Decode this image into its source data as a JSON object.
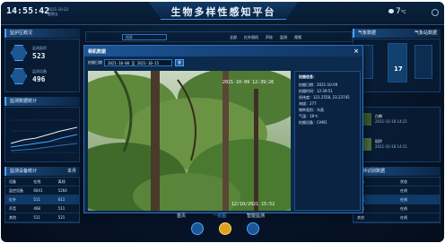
{
  "header": {
    "time": "14:55:42",
    "date_line1": "2021-10-22",
    "date_line2": "星期五",
    "title": "生物多样性感知平台",
    "weather_temp": "7",
    "weather_unit": "°C"
  },
  "left": {
    "panel1_title": "监护区概况",
    "stat1_label": "监测面积",
    "stat1_value": "523",
    "stat1_unit": "",
    "stat2_label": "监测设备",
    "stat2_value": "496",
    "stat2_unit": "",
    "panel2_title": "监测数据统计",
    "panel3_title": "监测设备统计",
    "panel3_filter": "本月",
    "table_headers": [
      "设备",
      "在线",
      "离线"
    ],
    "table_rows": [
      [
        "监控设备",
        "6041",
        "5264"
      ],
      [
        "红外",
        "511",
        "611"
      ],
      [
        "声音",
        "468",
        "511"
      ],
      [
        "其他",
        "511",
        "521"
      ]
    ]
  },
  "center_bar": {
    "search_placeholder": "搜索",
    "toolbar_items": [
      "全部",
      "红外相机",
      "声纹",
      "监测",
      "视频"
    ]
  },
  "right": {
    "panel1_title": "气象数据",
    "panel1_filter": "气象站数据",
    "temp_value": "17",
    "panel3_title": "物种识别数据",
    "species": [
      {
        "name": "白鹇",
        "date": "2021-10-18 14:21"
      },
      {
        "name": "斑羚",
        "date": "2021-10-18 14:21"
      }
    ],
    "table_headers": [
      "设备",
      "状态"
    ],
    "table_rows": [
      [
        "红外",
        "在线"
      ],
      [
        "声音",
        "在线"
      ],
      [
        "视频",
        "在线"
      ],
      [
        "其他",
        "在线"
      ]
    ]
  },
  "modal": {
    "title": "相机数据",
    "close": "×",
    "filter_label": "拍摄日期",
    "date_range": "2021-10-08 至 2021-10-15",
    "search_btn": "查",
    "photo_stamp_top": "2021-10-09 12:39:26",
    "photo_stamp_bottom": "12/10/2021 15:52",
    "info_title": "拍摄信息：",
    "info_lines": [
      "拍摄日期：2021-10-09",
      "拍摄时间：12:39:51",
      "经纬度：121.2558, 23.23745",
      "海拔：277",
      "物种类别：鸟类",
      "气温：18℃",
      "拍摄设备：CAM1"
    ]
  },
  "bottom_nav": {
    "items": [
      "首页",
      "一张图",
      "智能监测"
    ]
  }
}
